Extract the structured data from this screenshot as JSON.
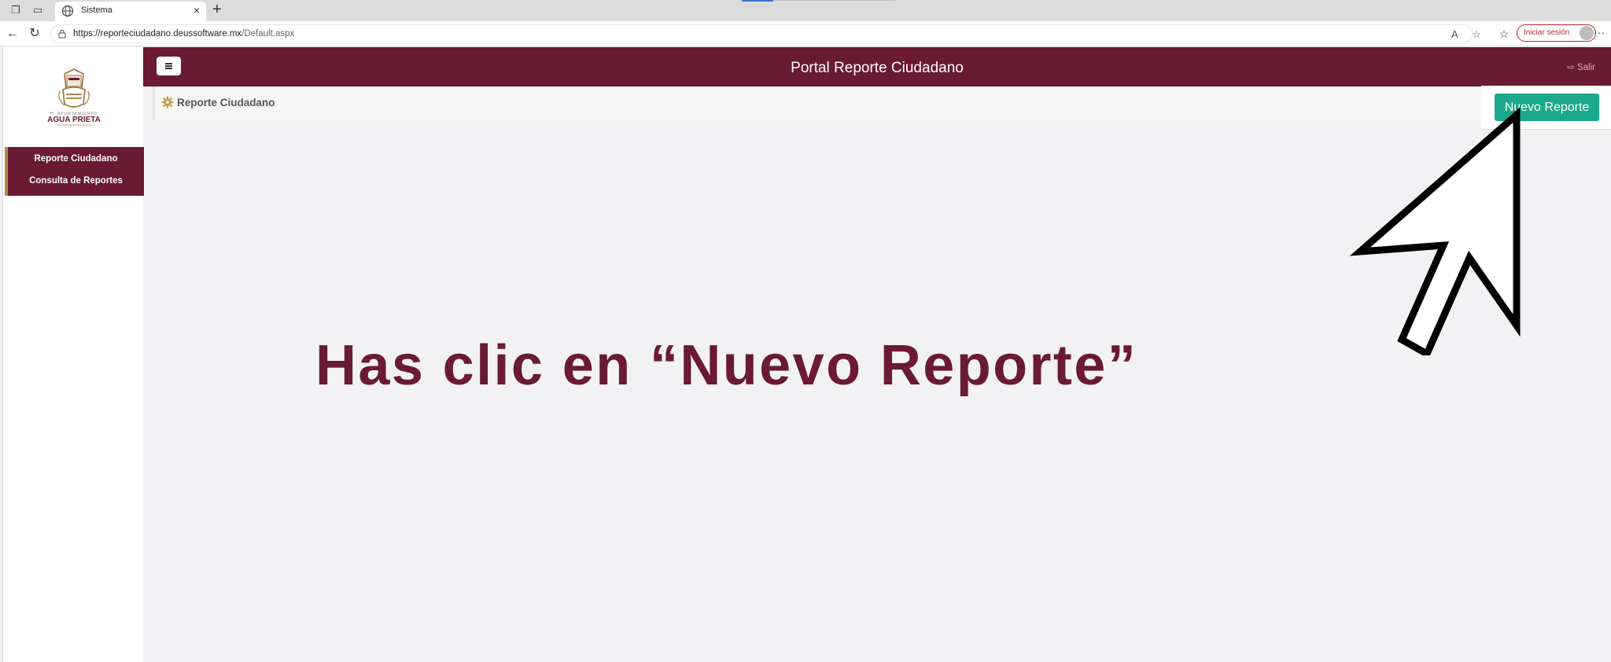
{
  "browser": {
    "tab_title": "Sistema",
    "tab_close": "×",
    "new_tab": "+",
    "url_host": "https://reporteciudadano.deussoftware.mx",
    "url_path": "/Default.aspx",
    "signin_label": "Iniciar sesión",
    "more": "···"
  },
  "sidebar": {
    "brand_small": "H. AYUNTAMIENTO",
    "brand_name": "AGUA PRIETA",
    "items": [
      {
        "label": "Reporte Ciudadano"
      },
      {
        "label": "Consulta de Reportes"
      }
    ]
  },
  "topbar": {
    "title": "Portal Reporte Ciudadano",
    "logout": "Salir"
  },
  "subbar": {
    "title": "Reporte Ciudadano"
  },
  "actions": {
    "new_report": "Nuevo Reporte"
  },
  "overlay": {
    "instruction": "Has clic en “Nuevo Reporte”"
  },
  "colors": {
    "brand": "#6a1a33",
    "accent_gold": "#b0894e",
    "button_green": "#1aa98c"
  }
}
